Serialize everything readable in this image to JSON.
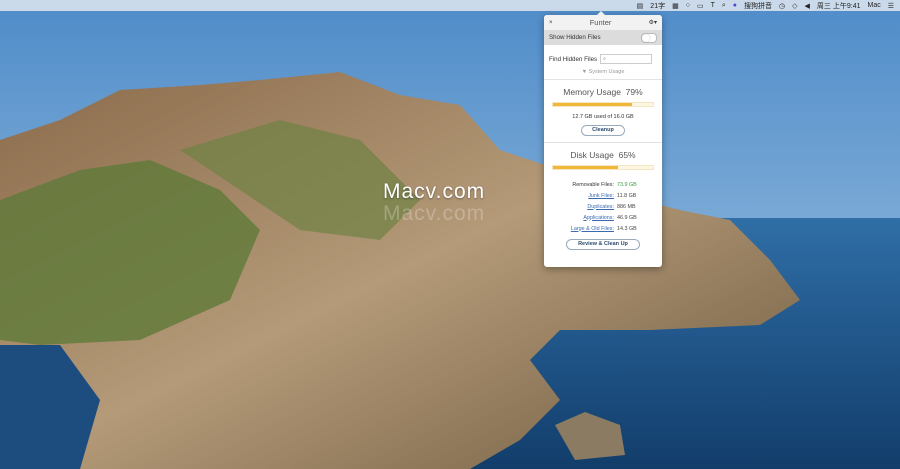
{
  "menubar": {
    "items": [
      "21字",
      "搜狗拼音",
      "周三 上午9:41",
      "Mac"
    ]
  },
  "popup": {
    "title": "Funter",
    "show_hidden": "Show Hidden Files",
    "find_hidden": "Find Hidden Files",
    "system_usage": "System Usage",
    "memory": {
      "label": "Memory Usage",
      "percent_text": "79%",
      "percent": 79,
      "note": "12.7 GB used of 16.0 GB",
      "button": "Cleanup"
    },
    "disk": {
      "label": "Disk Usage",
      "percent_text": "65%",
      "percent": 65,
      "button": "Review & Clean Up",
      "stats": [
        {
          "label": "Removable Files:",
          "value": "73.9 GB",
          "link": false
        },
        {
          "label": "Junk Files:",
          "value": "11.8 GB",
          "link": true
        },
        {
          "label": "Duplicates:",
          "value": "886 MB",
          "link": true
        },
        {
          "label": "Applications:",
          "value": "46.9 GB",
          "link": true
        },
        {
          "label": "Large & Old Files:",
          "value": "14.3 GB",
          "link": true
        }
      ]
    }
  },
  "watermark": "Macv.com",
  "colors": {
    "accent": "#f0b73a",
    "green": "#3aa043",
    "link": "#3a6ab0"
  }
}
